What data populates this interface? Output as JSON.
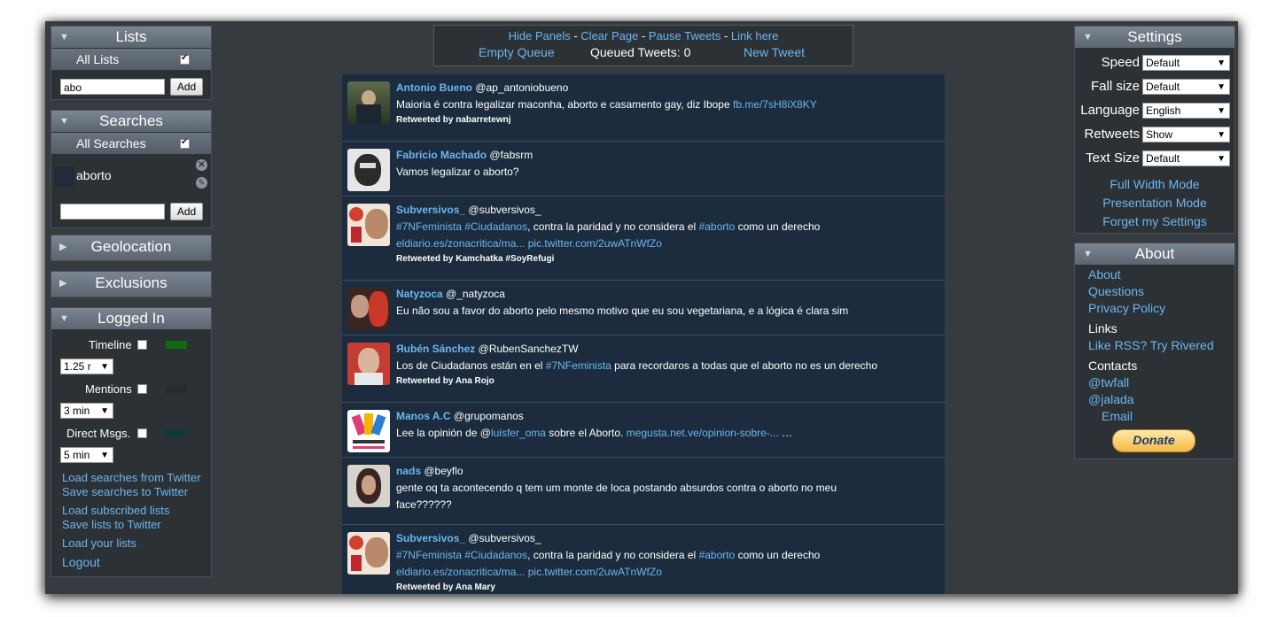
{
  "left": {
    "lists": {
      "title": "Lists",
      "all_label": "All Lists",
      "input_value": "abo",
      "add_label": "Add"
    },
    "searches": {
      "title": "Searches",
      "all_label": "All Searches",
      "items": [
        {
          "label": "aborto",
          "color": "#1f2d3d"
        }
      ],
      "input_value": "",
      "add_label": "Add"
    },
    "geolocation": {
      "title": "Geolocation"
    },
    "exclusions": {
      "title": "Exclusions"
    },
    "logged_in": {
      "title": "Logged In",
      "feeds": [
        {
          "label": "Timeline",
          "color": "#0f6b12",
          "interval": "1.25 r"
        },
        {
          "label": "Mentions",
          "color": "#2a2a2a",
          "interval": "3 min"
        },
        {
          "label": "Direct Msgs.",
          "color": "#0f3b34",
          "interval": "5 min"
        }
      ],
      "links": [
        "Load searches from Twitter",
        "Save searches to Twitter",
        "Load subscribed lists",
        "Save lists to Twitter",
        "Load your lists",
        "Logout"
      ]
    }
  },
  "topbar": {
    "hide_panels": "Hide Panels",
    "clear_page": "Clear Page",
    "pause_tweets": "Pause Tweets",
    "link_here": "Link here",
    "sep": " - ",
    "empty_queue": "Empty Queue",
    "queued": "Queued Tweets: 0",
    "new_tweet": "New Tweet"
  },
  "tweets": [
    {
      "name": "Antonio Bueno",
      "handle": "@ap_antoniobueno",
      "text": "Maioria é contra legalizar maconha, aborto e casamento gay, diz Ibope ",
      "link": "fb.me/7sH8iX8KY",
      "retweet": "Retweeted by nabarretewnj",
      "avatar": "#4b5a3a"
    },
    {
      "name": "Fabricio Machado",
      "handle": "@fabsrm",
      "text": "Vamos legalizar o aborto?",
      "avatar": "#8a8a8a"
    },
    {
      "name": "Subversivos_",
      "handle": "@subversivos_",
      "tag1": "#7NFeminista",
      "tag2": "#Ciudadanos",
      "text_mid": ", contra la paridad y no considera el ",
      "tag3": "#aborto",
      "text_end": " como un derecho",
      "link1": "eldiario.es/zonacritica/ma...",
      "link2": "pic.twitter.com/2uwATnWfZo",
      "retweet": "Retweeted by Kamchatka #SoyRefugi",
      "avatar": "#e9d8c8"
    },
    {
      "name": "Natyzoca",
      "handle": "@_natyzoca",
      "text": "Eu não sou a favor do aborto pelo mesmo motivo que eu sou vegetariana, e a lógica é clara sim",
      "avatar": "#b0413a"
    },
    {
      "name": "Яubén Sánchez",
      "handle": "@RubenSanchezTW",
      "text_pre": "Los de Ciudadanos están en el ",
      "tag": "#7NFeminista",
      "text_post": " para recordaros a todas que el aborto no es un derecho",
      "retweet": "Retweeted by Ana Rojo",
      "avatar": "#c8433a"
    },
    {
      "name": "Manos A.C",
      "handle": "@grupomanos",
      "text_pre": "Lee la opinión de @",
      "mention": "luisfer_oma",
      "text_mid": " sobre el Aborto. ",
      "link": "megusta.net.ve/opinion-sobre-...",
      "text_end": " …",
      "avatar": "#ffffff"
    },
    {
      "name": "nads",
      "handle": "@beyflo",
      "text": "gente oq ta acontecendo q tem um monte de loca postando absurdos contra o aborto no meu face??????",
      "avatar": "#5a3a30"
    },
    {
      "name": "Subversivos_",
      "handle": "@subversivos_",
      "tag1": "#7NFeminista",
      "tag2": "#Ciudadanos",
      "text_mid": ", contra la paridad y no considera el ",
      "tag3": "#aborto",
      "text_end": " como un derecho",
      "link1": "eldiario.es/zonacritica/ma...",
      "link2": "pic.twitter.com/2uwATnWfZo",
      "retweet": "Retweeted by Ana Mary",
      "avatar": "#e9d8c8"
    }
  ],
  "right": {
    "settings": {
      "title": "Settings",
      "rows": [
        {
          "label": "Speed",
          "value": "Default"
        },
        {
          "label": "Fall size",
          "value": "Default"
        },
        {
          "label": "Language",
          "value": "English"
        },
        {
          "label": "Retweets",
          "value": "Show"
        },
        {
          "label": "Text Size",
          "value": "Default"
        }
      ],
      "links": [
        "Full Width Mode",
        "Presentation Mode",
        "Forget my Settings"
      ]
    },
    "about": {
      "title": "About",
      "links1": [
        "About",
        "Questions",
        "Privacy Policy"
      ],
      "links_heading": "Links",
      "rss": "Like RSS? Try Rivered",
      "contacts_heading": "Contacts",
      "contacts": [
        "@twfall",
        "@jalada"
      ],
      "email": "Email",
      "donate": "Donate"
    }
  }
}
